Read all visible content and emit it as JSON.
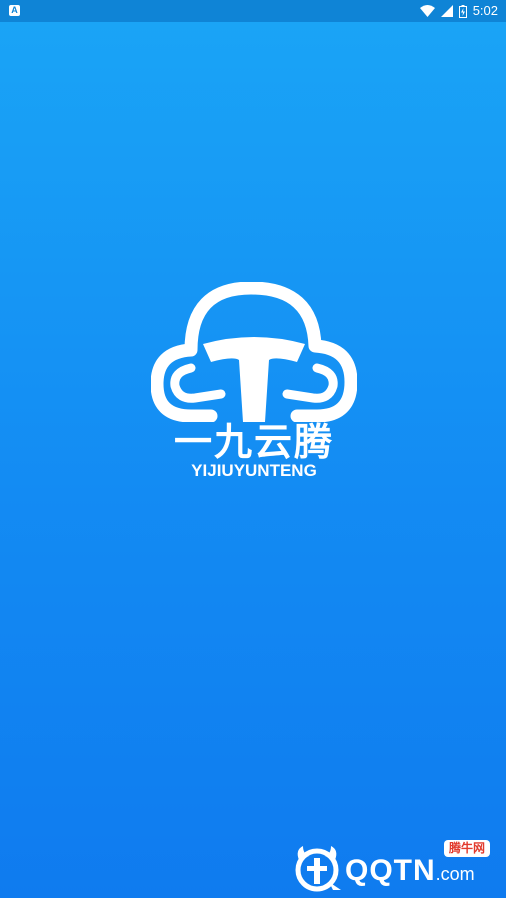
{
  "status_bar": {
    "notification_icon": "app-notification-icon",
    "notification_glyph": "A",
    "time": "5:02",
    "icons": [
      "wifi-icon",
      "cell-signal-icon",
      "battery-icon"
    ]
  },
  "splash": {
    "logo_icon": "cloud-logo-icon",
    "brand_cn": "一九云腾",
    "brand_en": "YIJIUYUNTENG"
  },
  "watermark": {
    "logo_icon": "qqtn-bull-icon",
    "badge": "腾牛网",
    "site": "QQTN",
    "domain": ".com"
  },
  "colors": {
    "background_top": "#1aa5f6",
    "background_bottom": "#0f7bef",
    "status_bar": "#0f84d6",
    "logo": "#ffffff",
    "watermark_badge_text": "#e23b2e"
  }
}
